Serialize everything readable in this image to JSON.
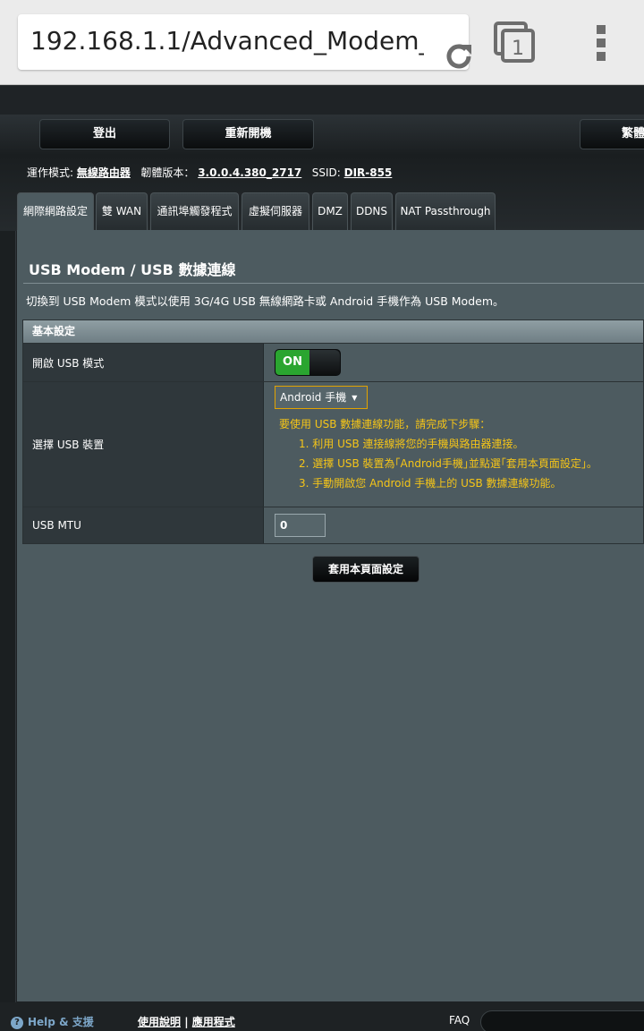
{
  "browser": {
    "url": "192.168.1.1/Advanced_Modem_",
    "tab_count": "1"
  },
  "header": {
    "logout_label": "登出",
    "reboot_label": "重新開機",
    "language_label": "繁體"
  },
  "status": {
    "mode_label": "運作模式:",
    "mode_value": "無線路由器",
    "firmware_label": "韌體版本：",
    "firmware_value": "3.0.0.4.380_2717",
    "ssid_label": "SSID:",
    "ssid_value": "DIR-855"
  },
  "tabs": [
    {
      "label": "網際網路設定"
    },
    {
      "label": "雙 WAN"
    },
    {
      "label": "通訊埠觸發程式"
    },
    {
      "label": "虛擬伺服器"
    },
    {
      "label": "DMZ"
    },
    {
      "label": "DDNS"
    },
    {
      "label": "NAT Passthrough"
    }
  ],
  "content": {
    "title": "USB Modem / USB 數據連線",
    "description": "切換到 USB Modem 模式以使用 3G/4G USB 無線網路卡或 Android 手機作為 USB Modem。",
    "section_title": "基本設定",
    "enable_usb_label": "開啟 USB 模式",
    "toggle_state": "ON",
    "select_device_label": "選擇 USB 裝置",
    "device_selected": "Android 手機",
    "help_intro": "要使用 USB 數據連線功能，請完成下步驟：",
    "help_steps": [
      "1.  利用 USB 連接線將您的手機與路由器連接。",
      "2.  選擇 USB 裝置為｢Android手機｣並點選｢套用本頁面設定｣。",
      "3.  手動開啟您 Android 手機上的 USB 數據連線功能。"
    ],
    "mtu_label": "USB MTU",
    "mtu_value": "0",
    "apply_label": "套用本頁面設定"
  },
  "footer": {
    "help_label": "Help & 支援",
    "manual_link": "使用說明",
    "separator": "|",
    "app_link": "應用程式",
    "faq_label": "FAQ"
  },
  "colors": {
    "panel": "#4d5b60",
    "accent_yellow": "#f5c518",
    "toggle_green": "#2aa530",
    "help_blue": "#7da7c9"
  }
}
